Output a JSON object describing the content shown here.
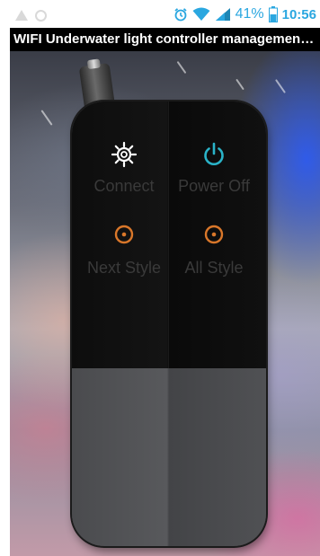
{
  "status_bar": {
    "battery_percent": "41%",
    "time": "10:56",
    "accent_color": "#2aa7e0",
    "icons": [
      "warning-icon",
      "circle-icon",
      "alarm-icon",
      "wifi-icon",
      "signal-icon",
      "battery-icon"
    ]
  },
  "title_bar": {
    "title": "WIFI Underwater light controller management sys..."
  },
  "remote": {
    "buttons": [
      {
        "label": "Connect",
        "icon": "gear-icon",
        "icon_color": "#ffffff"
      },
      {
        "label": "Power Off",
        "icon": "power-icon",
        "icon_color": "#2ab3c8"
      },
      {
        "label": "Next Style",
        "icon": "target-icon",
        "icon_color": "#d9772a"
      },
      {
        "label": "All Style",
        "icon": "target-icon",
        "icon_color": "#d9772a"
      }
    ]
  }
}
